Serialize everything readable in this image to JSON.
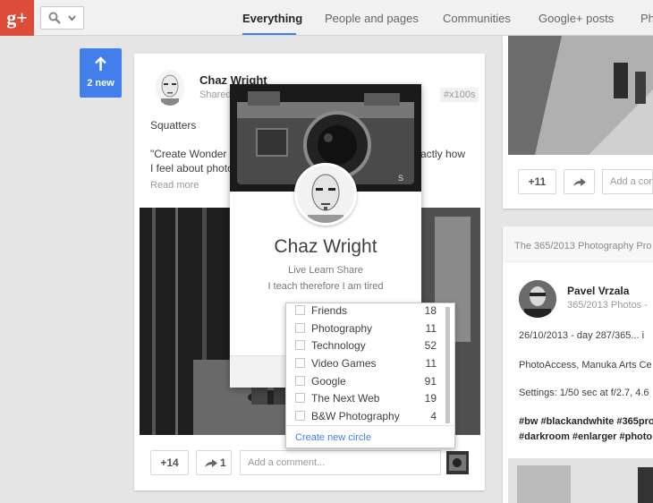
{
  "topbar": {
    "logo": "g+",
    "tabs": [
      {
        "label": "Everything",
        "active": true
      },
      {
        "label": "People and pages"
      },
      {
        "label": "Communities"
      },
      {
        "label": "Google+ posts"
      },
      {
        "label": "Ph"
      }
    ]
  },
  "new_posts": {
    "count": "2 new"
  },
  "post": {
    "author": "Chaz Wright",
    "shared": "Shared",
    "hashtag": "#x100s",
    "title": "Squatters",
    "text_line1": "\"Create Wonder a",
    "text_line1_end": "actly how",
    "text_line2": "I feel about photo",
    "read_more": "Read more",
    "plus_count": "+14",
    "share_count": "1",
    "comment_placeholder": "Add a comment..."
  },
  "hovercard": {
    "name": "Chaz Wright",
    "tagline": "Live Learn Share",
    "tagline2": "I teach therefore I am tired"
  },
  "circles": {
    "items": [
      {
        "name": "Friends",
        "count": "18"
      },
      {
        "name": "Photography",
        "count": "11"
      },
      {
        "name": "Technology",
        "count": "52"
      },
      {
        "name": "Video Games",
        "count": "11"
      },
      {
        "name": "Google",
        "count": "91"
      },
      {
        "name": "The Next Web",
        "count": "19"
      },
      {
        "name": "B&W Photography",
        "count": "4"
      }
    ],
    "create": "Create new circle"
  },
  "right_top": {
    "plus_count": "+11",
    "comment_placeholder": "Add a com"
  },
  "right_post": {
    "community": "The 365/2013 Photography Pro",
    "author": "Pavel Vrzala",
    "source": "365/2013 Photos -",
    "line1": "26/10/2013 - day 287/365...   i",
    "line2": "PhotoAccess, Manuka Arts Ce",
    "line3": "Settings: 1/50 sec at f/2.7, 4.6",
    "tags1": "#bw #blackandwhite #365pro",
    "tags2": "#darkroom #enlarger #photo"
  }
}
